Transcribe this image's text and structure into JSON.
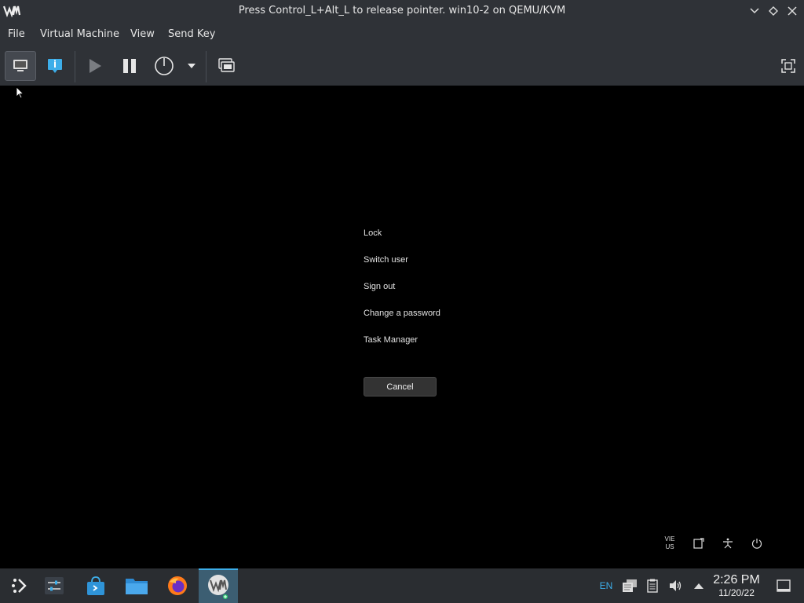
{
  "window": {
    "title": "Press Control_L+Alt_L to release pointer. win10-2 on QEMU/KVM",
    "buttons": [
      "minimize-icon",
      "maximize-icon",
      "close-icon"
    ]
  },
  "menubar": {
    "items": [
      "File",
      "Virtual Machine",
      "View",
      "Send Key"
    ]
  },
  "toolbar": {
    "buttons": [
      "console-icon",
      "details-icon",
      "run-icon",
      "pause-icon",
      "power-icon",
      "power-menu-chevron-icon",
      "snapshots-icon",
      "fullscreen-icon"
    ]
  },
  "guest": {
    "options": [
      "Lock",
      "Switch user",
      "Sign out",
      "Change a password",
      "Task Manager"
    ],
    "cancel_label": "Cancel",
    "language": {
      "line1": "VIE",
      "line2": "US"
    },
    "tray_icons": [
      "network-icon",
      "accessibility-icon",
      "power-icon"
    ]
  },
  "taskbar": {
    "apps": [
      "application-launcher-icon",
      "system-settings-icon",
      "discover-store-icon",
      "file-manager-icon",
      "firefox-icon",
      "virt-manager-icon"
    ],
    "tray": {
      "lang": "EN",
      "icons": [
        "clipboard-icon",
        "notes-icon",
        "volume-icon",
        "expand-tray-icon"
      ]
    },
    "clock": {
      "time": "2:26 PM",
      "date": "11/20/22"
    },
    "show_desktop_icon": "show-desktop-icon"
  },
  "colors": {
    "chrome": "#2f3237",
    "accent": "#3daee9",
    "guest_bg": "#000000"
  }
}
